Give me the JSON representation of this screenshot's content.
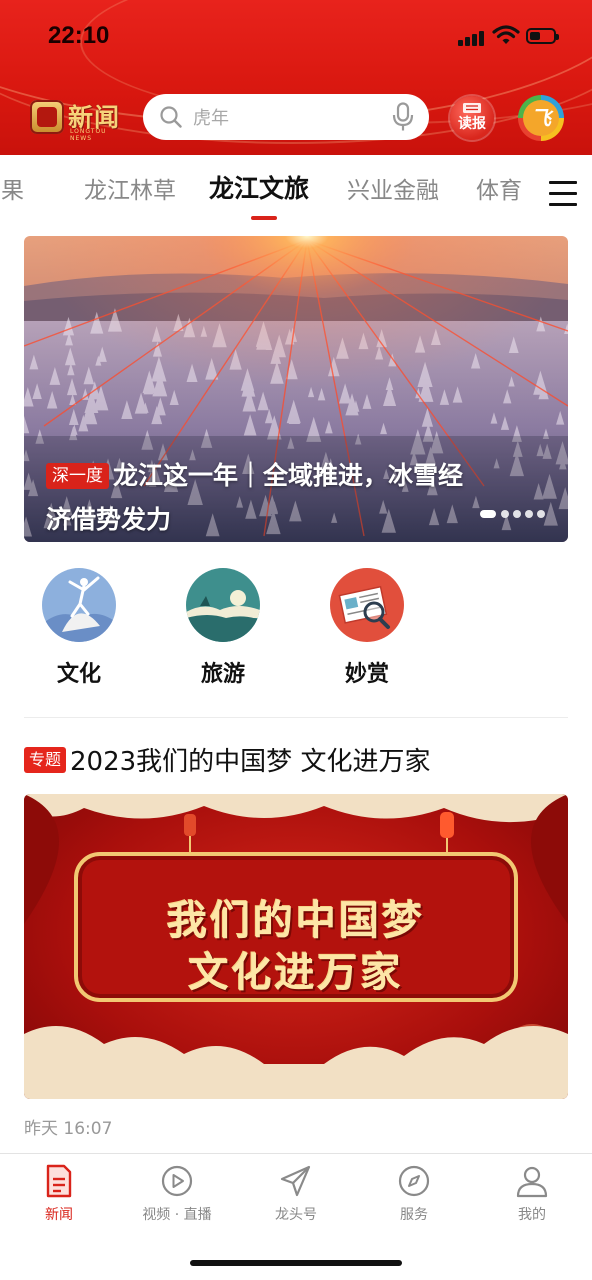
{
  "status_bar": {
    "time": "22:10",
    "battery_level": 0.45
  },
  "header": {
    "logo_text": "新闻",
    "logo_sub": "LONGTOU NEWS",
    "search": {
      "placeholder": "虎年"
    },
    "read_paper_label": "读报",
    "avatar_text": "飞"
  },
  "tabs": {
    "items": [
      {
        "label": "成果",
        "active": false
      },
      {
        "label": "龙江林草",
        "active": false
      },
      {
        "label": "龙江文旅",
        "active": true
      },
      {
        "label": "兴业金融",
        "active": false
      },
      {
        "label": "体育",
        "active": false
      }
    ]
  },
  "hero": {
    "tag": "深一度",
    "title": "龙江这一年｜全域推进，冰雪经济借势发力",
    "slides": 5,
    "current_slide": 1
  },
  "categories": [
    {
      "label": "文化",
      "icon": "dancer-icon"
    },
    {
      "label": "旅游",
      "icon": "landscape-icon"
    },
    {
      "label": "妙赏",
      "icon": "magnifier-paper-icon"
    }
  ],
  "topic": {
    "tag": "专题",
    "title": "2023我们的中国梦  文化进万家",
    "banner_line1": "我们的中国梦",
    "banner_line2": "文化进万家",
    "timestamp": "昨天  16:07"
  },
  "bottom_nav": [
    {
      "label": "新闻",
      "icon": "news-icon",
      "active": true
    },
    {
      "label": "视频 · 直播",
      "icon": "play-icon",
      "active": false
    },
    {
      "label": "龙头号",
      "icon": "paper-plane-icon",
      "active": false
    },
    {
      "label": "服务",
      "icon": "compass-icon",
      "active": false
    },
    {
      "label": "我的",
      "icon": "person-icon",
      "active": false
    }
  ],
  "colors": {
    "brand_red": "#d9231a",
    "header_red": "#e8231c",
    "tag_red": "#e5261c"
  }
}
